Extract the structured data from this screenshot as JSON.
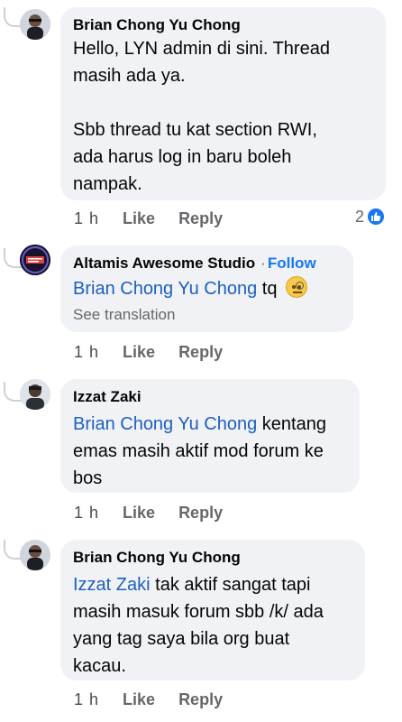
{
  "comments": [
    {
      "author": "Brian Chong Yu Chong",
      "lines": [
        "Hello, LYN admin di sini. Thread",
        "masih ada ya.",
        "",
        "Sbb thread tu kat section RWI,",
        "ada harus log in baru boleh",
        "nampak."
      ],
      "time": "1 h",
      "like": "Like",
      "reply": "Reply",
      "reaction_count": "2"
    },
    {
      "author": "Altamis Awesome Studio",
      "follow_sep": "·",
      "follow": "Follow",
      "mention": "Brian Chong Yu Chong",
      "text": "tq",
      "see_translation": "See translation",
      "time": "1 h",
      "like": "Like",
      "reply": "Reply"
    },
    {
      "author": "Izzat Zaki",
      "mention": "Brian Chong Yu Chong",
      "line1_rest": "kentang",
      "line2": "emas masih aktif mod forum ke",
      "line3": "bos",
      "time": "1 h",
      "like": "Like",
      "reply": "Reply"
    },
    {
      "author": "Brian Chong Yu Chong",
      "mention": "Izzat Zaki",
      "line1_rest": "tak aktif sangat tapi",
      "line2": "masih masuk forum sbb /k/ ada",
      "line3": "yang tag saya bila org buat",
      "line4": "kacau.",
      "time": "1 h",
      "like": "Like",
      "reply": "Reply"
    }
  ],
  "colors": {
    "mention": "#1e5fbf",
    "bubble": "#f0f2f5",
    "follow": "#1877f2"
  }
}
